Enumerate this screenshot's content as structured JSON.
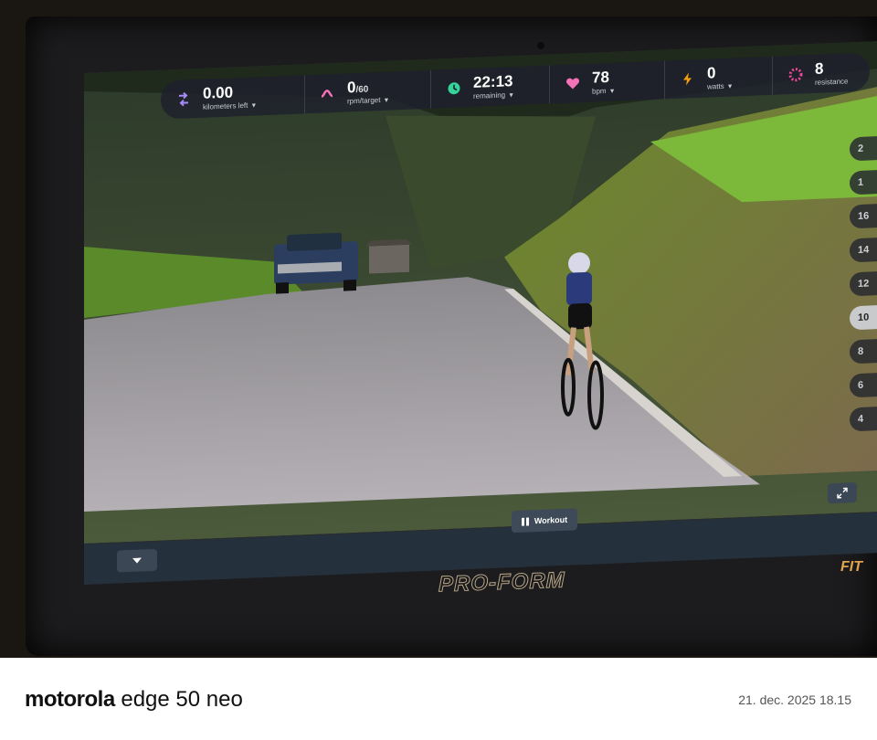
{
  "hud": {
    "stats": [
      {
        "value": "0.00",
        "sub": "",
        "label": "kilometers left",
        "icon": "route-icon",
        "color": "#a78bfa"
      },
      {
        "value": "0",
        "sub": "/60",
        "label": "rpm/target",
        "icon": "cadence-icon",
        "color": "#f472b6"
      },
      {
        "value": "22:13",
        "sub": "",
        "label": "remaining",
        "icon": "clock-icon",
        "color": "#34d399"
      },
      {
        "value": "78",
        "sub": "",
        "label": "bpm",
        "icon": "heart-icon",
        "color": "#f472b6"
      },
      {
        "value": "0",
        "sub": "",
        "label": "watts",
        "icon": "lightning-icon",
        "color": "#f59e0b"
      },
      {
        "value": "8",
        "sub": "",
        "label": "resistance",
        "icon": "resistance-icon",
        "color": "#ec4899"
      }
    ]
  },
  "scale": {
    "levels": [
      "2",
      "1",
      "16",
      "14",
      "12",
      "10",
      "8",
      "6",
      "4"
    ],
    "selected": "10"
  },
  "controls": {
    "workout_label": "Workout"
  },
  "device": {
    "brand": "PRO-FORM",
    "badge": "FIT"
  },
  "caption": {
    "brand": "motorola",
    "model": "edge 50 neo",
    "timestamp": "21. dec. 2025 18.15"
  }
}
